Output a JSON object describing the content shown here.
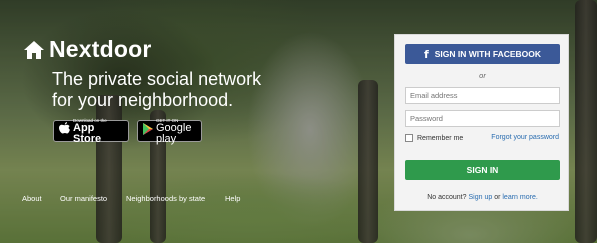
{
  "brand": {
    "name": "Nextdoor"
  },
  "hero": {
    "tagline_line1": "The private social network",
    "tagline_line2": "for your neighborhood."
  },
  "stores": {
    "apple_small": "Download on the",
    "apple_big": "App Store",
    "google_small": "GET IT ON",
    "google_big": "Google play"
  },
  "footer": {
    "links": [
      "About",
      "Our manifesto",
      "Neighborhoods by state",
      "Help"
    ]
  },
  "login": {
    "facebook_label": "SIGN IN WITH FACEBOOK",
    "facebook_icon": "f",
    "or_label": "or",
    "email_placeholder": "Email address",
    "password_placeholder": "Password",
    "remember_label": "Remember me",
    "forgot_label": "Forgot your password",
    "signin_label": "SIGN IN",
    "no_account_text": "No account?",
    "signup_label": "Sign up",
    "or_text": "or",
    "learn_more_label": "learn more."
  },
  "colors": {
    "facebook": "#3b5998",
    "signin": "#2f9a4c",
    "link": "#2a6db0"
  }
}
